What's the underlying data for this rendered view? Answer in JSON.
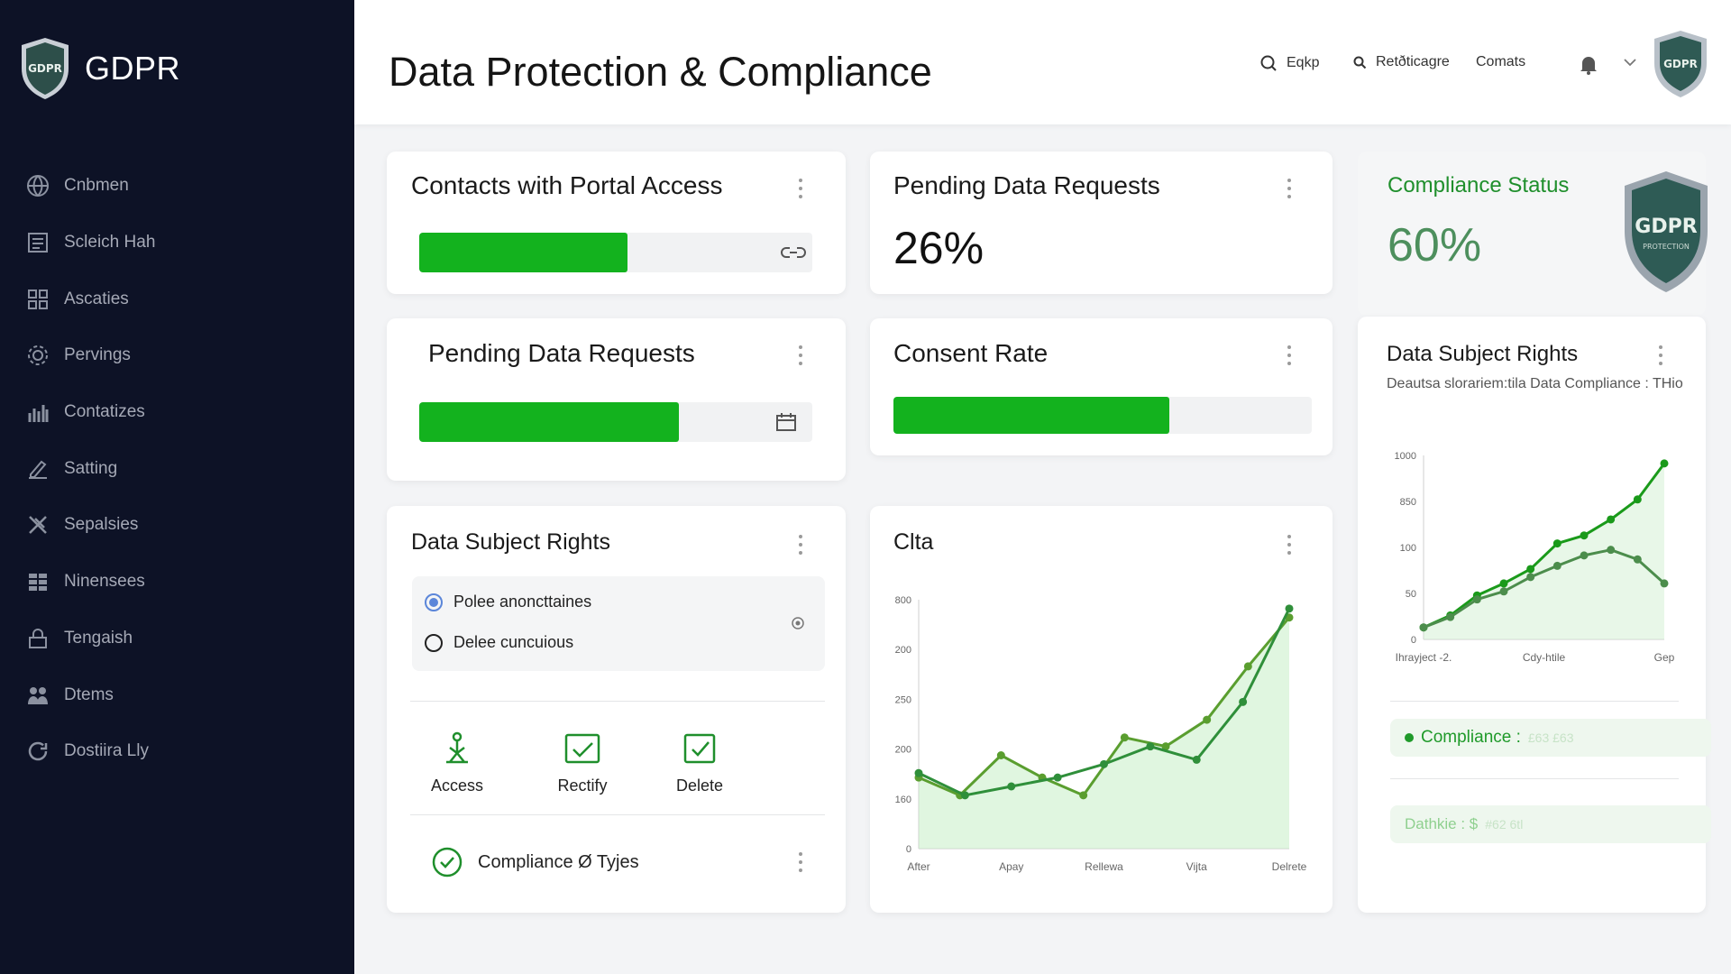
{
  "app": {
    "brand": "GDPR",
    "logo_text": "GDPR"
  },
  "sidebar": {
    "items": [
      {
        "label": "Cnbmen",
        "icon": "globe-icon"
      },
      {
        "label": "Scleich Hah",
        "icon": "document-icon"
      },
      {
        "label": "Ascaties",
        "icon": "grid-icon"
      },
      {
        "label": "Pervings",
        "icon": "gear-icon"
      },
      {
        "label": "Contatizes",
        "icon": "building-chart-icon"
      },
      {
        "label": "Satting",
        "icon": "edit-chart-icon"
      },
      {
        "label": "Sepalsies",
        "icon": "tools-icon"
      },
      {
        "label": "Ninensees",
        "icon": "table-icon"
      },
      {
        "label": "Tengaish",
        "icon": "lock-chart-icon"
      },
      {
        "label": "Dtems",
        "icon": "people-icon"
      },
      {
        "label": "Dostiira Lly",
        "icon": "refresh-icon"
      }
    ]
  },
  "header": {
    "title": "Data Protection & Compliance",
    "links": [
      {
        "label": "Eqkp",
        "icon": "search-icon"
      },
      {
        "label": "Retðticagre",
        "icon": "magnifier-icon"
      },
      {
        "label": "Comats",
        "icon": ""
      }
    ],
    "notification_icon": "bell-icon",
    "avatar_text": "GDPR"
  },
  "cards": {
    "portal_access": {
      "title": "Contacts with Portal Access",
      "progress": 0.53,
      "icon": "link-icon"
    },
    "pending_top": {
      "title": "Pending Data Requests",
      "value": "26%"
    },
    "compliance_status": {
      "title": "Compliance Status",
      "value": "60%",
      "badge_line1": "GDPR",
      "badge_line2": "PROTECTION"
    },
    "pending_second": {
      "title": "Pending Data Requests",
      "progress": 0.66,
      "icon": "calendar-icon"
    },
    "consent_rate": {
      "title": "Consent Rate",
      "progress": 0.66
    },
    "rights_left": {
      "title": "Data Subject Rights",
      "options": [
        {
          "label": "Polee anoncttaines",
          "selected": true
        },
        {
          "label": "Delee cuncuious",
          "selected": false
        }
      ],
      "actions": [
        {
          "label": "Access",
          "icon": "access-icon"
        },
        {
          "label": "Rectify",
          "icon": "rectify-icon"
        },
        {
          "label": "Delete",
          "icon": "delete-icon"
        }
      ],
      "footer": "Compliance Ø Tyjes"
    },
    "chart_middle": {
      "title": "Clta"
    },
    "rights_right": {
      "title": "Data Subject Rights",
      "subtitle": "Deautsa slorariem:tila Data Compliance : THio",
      "legend1_label": "Compliance :",
      "legend1_value": "£63 £63",
      "legend2_label": "Dathkie : $",
      "legend2_value": "#62 6tl"
    }
  },
  "chart_data": [
    {
      "type": "line",
      "title": "Clta",
      "categories": [
        "After",
        "Apay",
        "Rellewa",
        "Vijta",
        "Delrete"
      ],
      "y_ticks": [
        0,
        160,
        200,
        250,
        200,
        800
      ],
      "series": [
        {
          "values": [
            160,
            120,
            210,
            160,
            120,
            250,
            230,
            290,
            410,
            520
          ]
        },
        {
          "values": [
            170,
            120,
            140,
            160,
            190,
            230,
            200,
            330,
            540
          ]
        }
      ],
      "colors": [
        "#5a9e2f",
        "#2f8f3a"
      ],
      "fill": "#c6eec6"
    },
    {
      "type": "line",
      "categories": [
        "Ihrayject -2.",
        "Cdy-htile",
        "Gep"
      ],
      "y_ticks": [
        0,
        50,
        100,
        850,
        1000
      ],
      "series": [
        {
          "values": [
            15,
            30,
            55,
            70,
            88,
            120,
            130,
            150,
            175,
            220
          ]
        },
        {
          "values": [
            15,
            28,
            50,
            60,
            78,
            92,
            105,
            112,
            100,
            70
          ]
        }
      ],
      "colors": [
        "#1a9a1a",
        "#4c8d4c"
      ],
      "fill": "#d6f1d6"
    }
  ]
}
